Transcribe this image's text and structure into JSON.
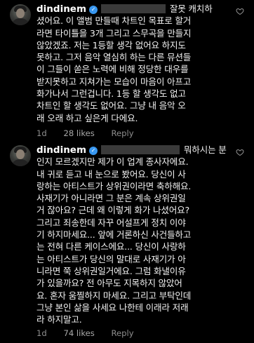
{
  "comments": [
    {
      "username": "dindinem",
      "lines": [
        "잘못 캐치하",
        "셨어요. 이 앨범 만들때 차트인 목표로 할거",
        "라면 타이틀을 3개 그리고 스무곡을 만들지",
        "않았겠죠. 저는 1등할 생각 없어요 하지도",
        "못하고. 그저 음악 열심히 하는 다른 뮤션들",
        "이 그들이 쏟은 노력에 비해 정당한 대우를",
        "받지못하고 지쳐가는 모습이 마음이 아프고",
        "화가나서 그런겁니다. 1등 할 생각도 없고",
        "차트인 할 생각도 없어요. 그냥 내 음악 오",
        "래 오래 하고 싶은게 다에요."
      ],
      "time": "1d",
      "likes": "28 likes",
      "reply": "Reply"
    },
    {
      "username": "dindinem",
      "lines": [
        "뭐하시는 분",
        "인지 모르겠지만 제가 이 업계 종사자에요.",
        "내 귀로 듣고 내 눈으로 봤어요. 당신이 사",
        "랑하는 아티스트가 상위권이라면 축하해요.",
        "사재기가 아니라면 그 분은 계속 상위권일",
        "거 잖아요? 근데 왜 이렇게 화가 나셨어요?",
        "그리고 죄송한데 자꾸 어설프게 정치 이야",
        "기 하지마세요... 앞에 거론하신 사건들하고",
        "는 전혀 다른 케이스에요... 당신이 사랑하",
        "는 아티스트가 당신의 말대로 사재기가 아",
        "니라면 쭉 상위권일거에요. 그럼 화낼이유",
        "가 있을까요? 전 아무도 지목하지 않았어",
        "요. 혼자 움찔하지 마세요. 그리고 부탁인데",
        "그냥 본인 삶을 사세요 나한테 이래라 저래",
        "라 하지말고."
      ],
      "time": "1d",
      "likes": "74 likes",
      "reply": "Reply"
    }
  ],
  "colors": {
    "background": "#000000",
    "text": "#f2f2f2",
    "meta": "#8e8e8e",
    "verified": "#3897f0"
  },
  "icons": {
    "verified": "verified-badge-icon",
    "like": "heart-icon"
  }
}
